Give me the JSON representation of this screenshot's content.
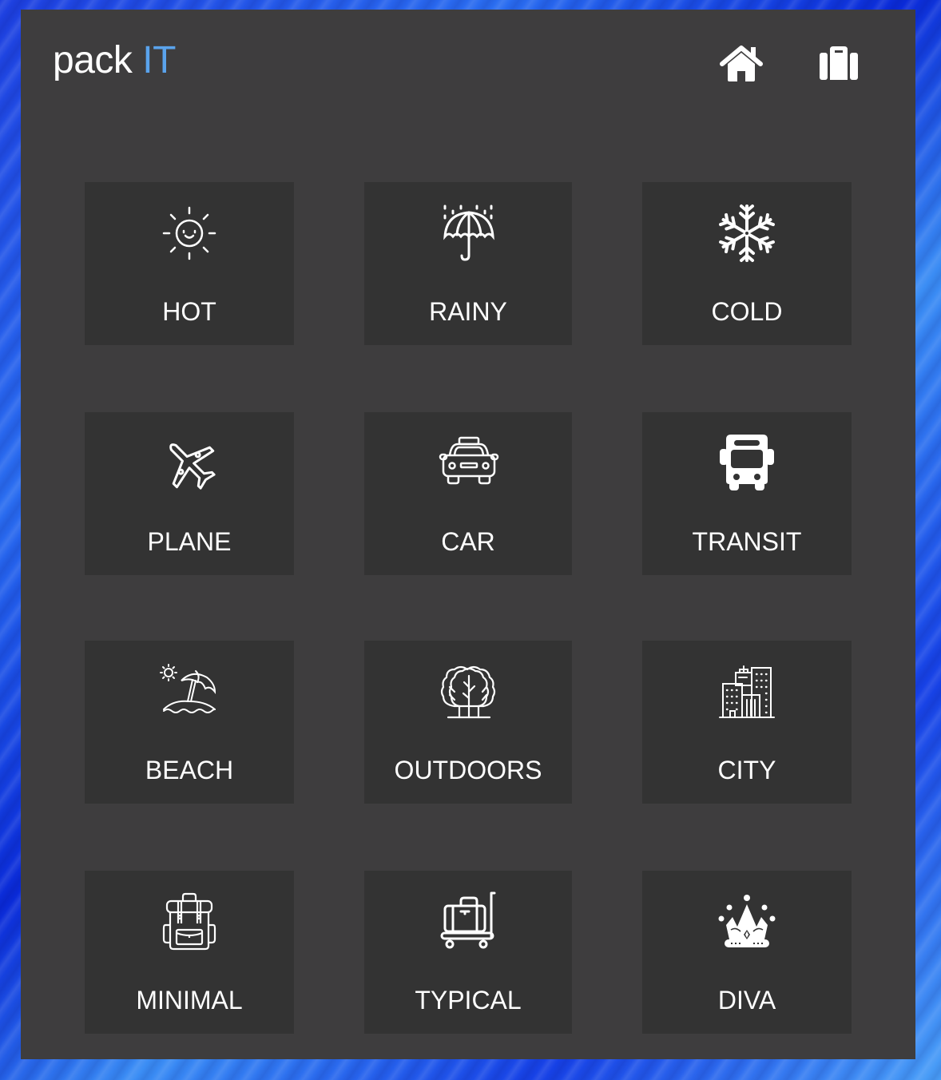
{
  "header": {
    "logo_text": "pack",
    "logo_accent": "IT",
    "accent_color": "#5aa3ec",
    "nav": [
      {
        "name": "home",
        "icon": "home-icon"
      },
      {
        "name": "packing-list",
        "icon": "suitcase-icon"
      }
    ]
  },
  "categories": [
    {
      "label": "HOT",
      "icon": "sun-icon"
    },
    {
      "label": "RAINY",
      "icon": "umbrella-rain-icon"
    },
    {
      "label": "COLD",
      "icon": "snowflake-icon"
    },
    {
      "label": "PLANE",
      "icon": "airplane-icon"
    },
    {
      "label": "CAR",
      "icon": "car-icon"
    },
    {
      "label": "TRANSIT",
      "icon": "bus-icon"
    },
    {
      "label": "BEACH",
      "icon": "beach-umbrella-icon"
    },
    {
      "label": "OUTDOORS",
      "icon": "trees-icon"
    },
    {
      "label": "CITY",
      "icon": "buildings-icon"
    },
    {
      "label": "MINIMAL",
      "icon": "backpack-icon"
    },
    {
      "label": "TYPICAL",
      "icon": "luggage-cart-icon"
    },
    {
      "label": "DIVA",
      "icon": "crown-icon"
    }
  ]
}
